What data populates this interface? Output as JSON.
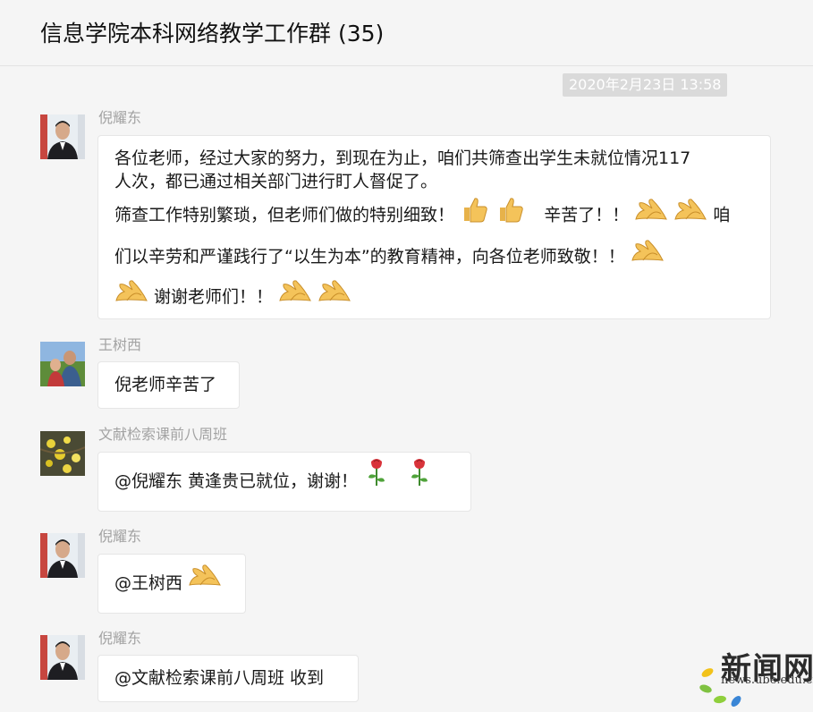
{
  "header": {
    "title": "信息学院本科网络教学工作群 (35)"
  },
  "timestamp": "2020年2月23日 13:58",
  "messages": [
    {
      "sender": "倪耀东",
      "lines": [
        "各位老师，经过大家的努力，到现在为止，咱们共筛查出学生未就位情况117",
        "人次，都已通过相关部门进行盯人督促了。",
        "筛查工作特别繁琐，但老师们做的特别细致！",
        "辛苦了！！",
        "咱",
        "们以辛劳和严谨践行了“以生为本”的教育精神，向各位老师致敬！！",
        "谢谢老师们！！"
      ]
    },
    {
      "sender": "王树西",
      "text": "倪老师辛苦了"
    },
    {
      "sender": "文献检索课前八周班",
      "text": "@倪耀东 黄逢贵已就位，谢谢！"
    },
    {
      "sender": "倪耀东",
      "text": "@王树西"
    },
    {
      "sender": "倪耀东",
      "text": "@文献检索课前八周班 收到"
    }
  ],
  "watermark": {
    "text": "新闻网",
    "url": "news.ube.edu.cn"
  },
  "icons": [
    "thumbs-up-icon",
    "clap-icon",
    "rose-icon",
    "avatar"
  ],
  "colors": {
    "background": "#f5f5f5",
    "bubble": "#ffffff",
    "sender": "#a3a3a3",
    "timestamp_bg": "#dadada"
  }
}
